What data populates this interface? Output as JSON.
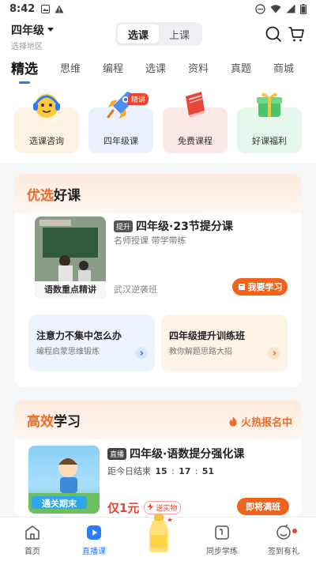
{
  "status_bar": {
    "time": "8:42"
  },
  "header": {
    "grade": "四年级",
    "region": "选择地区",
    "segments": [
      "选课",
      "上课"
    ],
    "active_segment": 0
  },
  "tabs": [
    "精选",
    "思维",
    "编程",
    "选课",
    "资料",
    "真题",
    "商城"
  ],
  "quick": [
    {
      "label": "选课咨询",
      "color": "#fdf3e3"
    },
    {
      "label": "四年级课",
      "color": "#e8f1fd",
      "badge": "精讲"
    },
    {
      "label": "免费课程",
      "color": "#fde8e8"
    },
    {
      "label": "好课福利",
      "color": "#e6f7ec"
    }
  ],
  "section1": {
    "title_accent": "优选",
    "title_rest": "好课",
    "course": {
      "tag": "提升",
      "title": "四年级·23节提分课",
      "subtitle": "名师授课 带学带练",
      "thumb_caption": "语数重点精讲",
      "class_name": "武汉逆袭班",
      "button": "我要学习"
    },
    "minis": [
      {
        "title": "注意力不集中怎么办",
        "subtitle": "编程启蒙思维锻炼"
      },
      {
        "title": "四年级提升训练班",
        "subtitle": "教你解题思路大招"
      }
    ]
  },
  "section2": {
    "title_accent": "高效",
    "title_rest": "学习",
    "hot": "火热报名中",
    "course": {
      "tag": "直播",
      "title": "四年级·语数提分强化课",
      "timer_label": "距今日结束",
      "timer": [
        "15",
        "17",
        "51"
      ],
      "price": "仅1元",
      "gift": "送实物",
      "button": "即将满班",
      "thumb_text": "通关期末"
    }
  },
  "bottom_nav": [
    {
      "label": "首页"
    },
    {
      "label": "直播课"
    },
    {
      "label": ""
    },
    {
      "label": "同步学练"
    },
    {
      "label": "签到有礼"
    }
  ],
  "colors": {
    "primary": "#2a7bf4",
    "accent": "#f0631d"
  }
}
